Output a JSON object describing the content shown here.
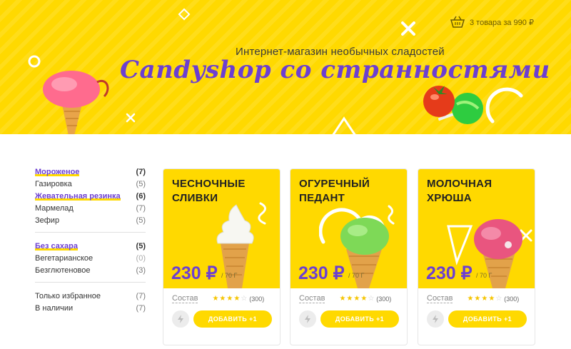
{
  "header": {
    "cart_text": "3 товара за 990 ₽",
    "tagline": "Интернет-магазин необычных сладостей",
    "logo": "Candyshop со странностями",
    "bg_color": "#ffd900",
    "logo_color": "#6c3fd1"
  },
  "sidebar": {
    "groups": [
      {
        "items": [
          {
            "label": "Мороженое",
            "count": "(7)"
          },
          {
            "label": "Газировка",
            "count": "(5)"
          },
          {
            "label": "Жевательная резинка",
            "count": "(6)"
          },
          {
            "label": "Мармелад",
            "count": "(7)"
          },
          {
            "label": "Зефир",
            "count": "(5)"
          }
        ]
      },
      {
        "items": [
          {
            "label": "Без сахара",
            "count": "(5)"
          },
          {
            "label": "Вегетарианское",
            "count": "(0)"
          },
          {
            "label": "Безглютеновое",
            "count": "(3)"
          }
        ]
      },
      {
        "items": [
          {
            "label": "Только избранное",
            "count": "(7)"
          },
          {
            "label": "В наличии",
            "count": "(7)"
          }
        ]
      }
    ]
  },
  "cards": [
    {
      "title": "Чесночные\nсливки",
      "price": "230 ₽",
      "unit": "/ 70 Г",
      "composition": "Состав",
      "rating": 4,
      "reviews": "(300)",
      "button": "ДОБАВИТЬ +1",
      "icon": "soft-serve-icecream"
    },
    {
      "title": "Огуречный\nпедант",
      "price": "230 ₽",
      "unit": "/ 70 Г",
      "composition": "Состав",
      "rating": 4,
      "reviews": "(300)",
      "button": "ДОБАВИТЬ +1",
      "icon": "green-scoop-icecream"
    },
    {
      "title": "Молочная\nхрюша",
      "price": "230 ₽",
      "unit": "/ 70 Г",
      "composition": "Состав",
      "rating": 4,
      "reviews": "(300)",
      "button": "ДОБАВИТЬ +1",
      "icon": "pink-scoop-icecream"
    }
  ]
}
